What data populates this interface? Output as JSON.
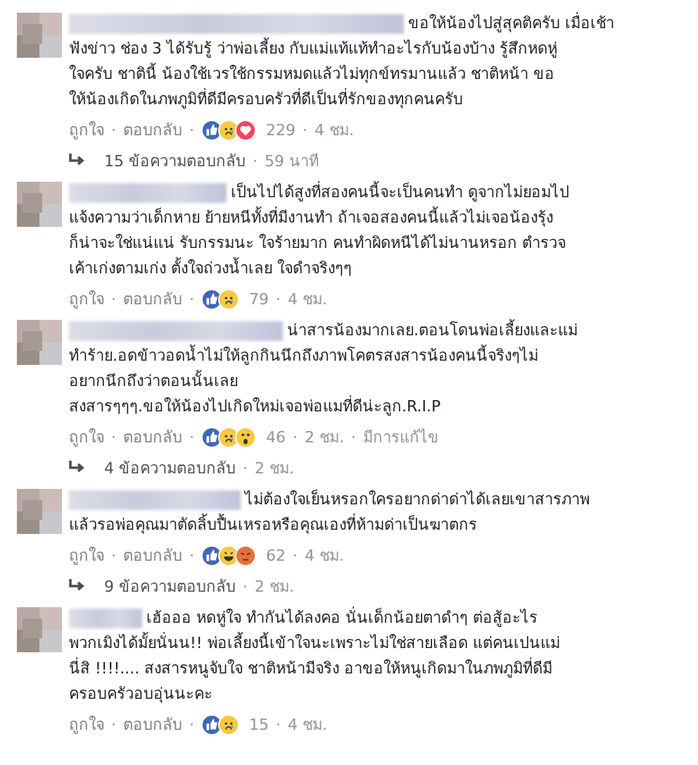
{
  "comments": [
    {
      "lines": [
        "ขอให้น้องไปสู่สุคติครับ เมื่อเช้า",
        "ฟังข่าว ช่อง 3 ได้รับรู้ ว่าพ่อเลี้ยง กับแม่แท้แท้ทำอะไรกับน้องบ้าง รู้สึกหดหู่",
        "ใจครับ ชาตินี้ น้องใช้เวรใช้กรรมหมดแล้วไม่ทุกข์ทรมานแล้ว ชาติหน้า ขอ",
        "ให้น้องเกิดในภพภูมิที่ดีมีครอบครัวที่ดีเป็นที่รักของทุกคนครับ"
      ],
      "like": "ถูกใจ",
      "reply": "ตอบกลับ",
      "reactions": [
        {
          "kind": "like"
        },
        {
          "kind": "sad"
        },
        {
          "kind": "love"
        }
      ],
      "count": "229",
      "time": "4 ชม.",
      "separators": [
        "·",
        "·",
        "·"
      ],
      "replies": {
        "label": "15 ข้อความตอบกลับ",
        "separator": "·",
        "time": "59 นาที"
      }
    },
    {
      "lines": [
        "เป็นไปได้สูงที่สองคนนี้จะเป็นคนทำ ดูจากไม่ยอมไป",
        "แจ้งความว่าเด็กหาย ย้ายหนีทั้งที่มีงานทำ ถ้าเจอสองคนนี้แล้วไม่เจอน้องรุ้ง",
        "ก็น่าจะใช่แน่แน่ รับกรรมนะ ใจร้ายมาก คนทำผิดหนีได้ไม่นานหรอก ตำรวจ",
        "เค้าเก่งตามเก่ง ตั้งใจถ่วงน้ำเลย ใจดำจริงๆๆ"
      ],
      "like": "ถูกใจ",
      "reply": "ตอบกลับ",
      "reactions": [
        {
          "kind": "like"
        },
        {
          "kind": "sad"
        }
      ],
      "count": "79",
      "time": "4 ชม.",
      "separators": [
        "·",
        "·",
        "·"
      ]
    },
    {
      "lines": [
        "น่าสารน้องมากเลย.ตอนโดนพ่อเลี้ยงและแม่",
        "ทำร้าย.อดข้าวอดน้ำไม่ให้ลูกกินนึกถึงภาพโคตรสงสารน้องคนนี้จริงๆไม่",
        "อยากนึกถึงว่าตอนนั้นเลย",
        "สงสารๆๆๆ.ขอให้น้องไปเกิดใหม่เจอพ่อแมที่ดีน่ะลูก.R.I.P"
      ],
      "like": "ถูกใจ",
      "reply": "ตอบกลับ",
      "reactions": [
        {
          "kind": "like"
        },
        {
          "kind": "sad"
        },
        {
          "kind": "wow"
        }
      ],
      "count": "46",
      "time": "2 ชม.",
      "separators": [
        "·",
        "·",
        "·",
        "·"
      ],
      "edited": "มีการแก้ไข",
      "replies": {
        "label": "4 ข้อความตอบกลับ",
        "separator": "·",
        "time": "2 ชม."
      }
    },
    {
      "lines": [
        "ไม่ต้องใจเย็นหรอกใครอยากด่าด่าได้เลยเขาสารภาพ",
        "แล้วรอพ่อคุณมาตัดลิ้บปื้นเหรอหรือคุณเองที่ห้ามด่าเป็นฆาตกร"
      ],
      "like": "ถูกใจ",
      "reply": "ตอบกลับ",
      "reactions": [
        {
          "kind": "like"
        },
        {
          "kind": "haha"
        },
        {
          "kind": "angry"
        }
      ],
      "count": "62",
      "time": "4 ชม.",
      "separators": [
        "·",
        "·",
        "·"
      ],
      "replies": {
        "label": "9 ข้อความตอบกลับ",
        "separator": "·",
        "time": "2 ชม."
      }
    },
    {
      "lines": [
        "เฮ้อออ หดหู่ใจ ทำกันได้ลงคอ นั่นเด็กน้อยตาดำๆ ต่อสู้อะไร",
        "พวกเมิงได้มั้ยนั่นน!! พ่อเลี้ยงนี้เข้าใจนะเพราะไม่ใช่สายเลือด แต่คนเปนแม่",
        "นี่สิ !!!!.... สงสารหนูจับใจ ชาติหน้ามีจริง อาขอให้หนูเกิดมาในภพภูมิที่ดีมี",
        "ครอบครัวอบอุ่นนะคะ"
      ],
      "like": "ถูกใจ",
      "reply": "ตอบกลับ",
      "reactions": [
        {
          "kind": "like"
        },
        {
          "kind": "sad"
        }
      ],
      "count": "15",
      "time": "4 ชม.",
      "separators": [
        "·",
        "·",
        "·"
      ]
    }
  ]
}
